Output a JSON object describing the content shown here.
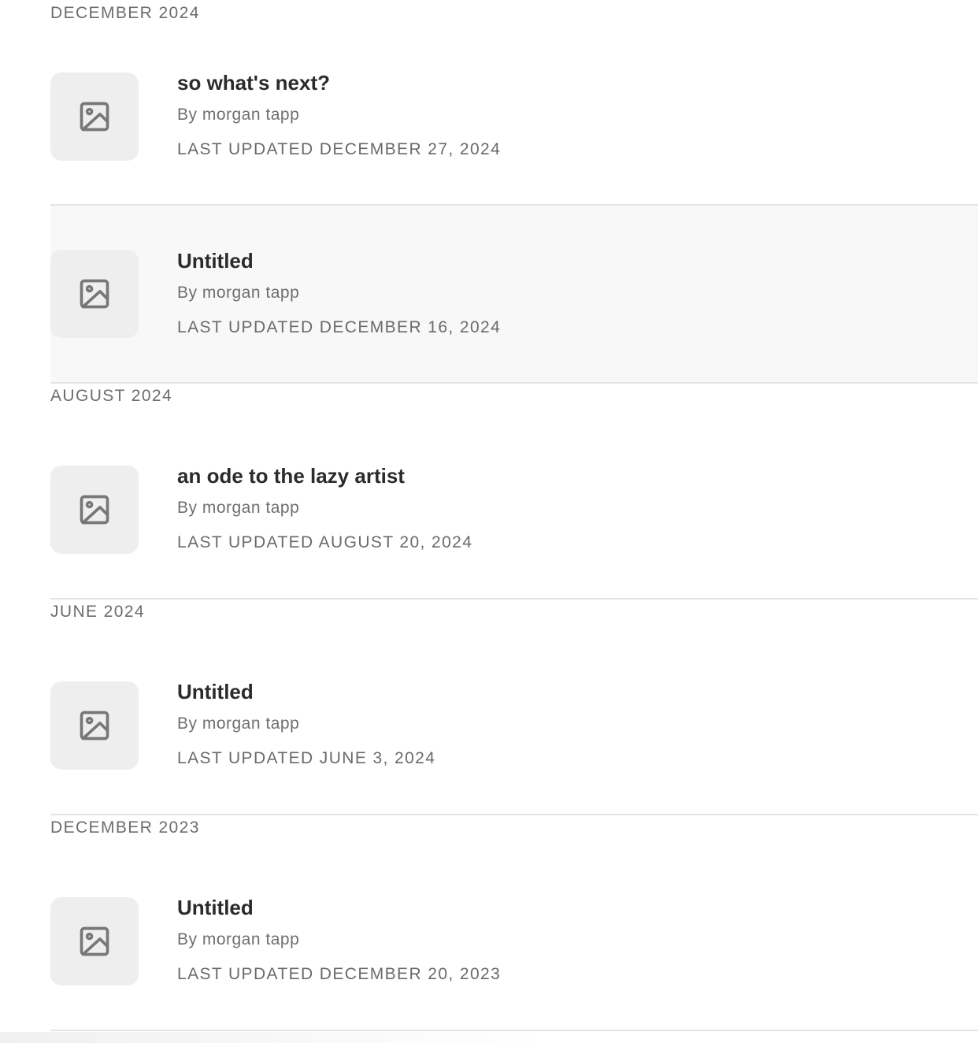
{
  "sections": [
    {
      "month": "DECEMBER 2024",
      "posts": [
        {
          "title": "so what's next?",
          "author": "By morgan tapp",
          "updated": "LAST UPDATED DECEMBER 27, 2024",
          "thumbnail_icon": "image-placeholder-icon"
        },
        {
          "title": "Untitled",
          "author": "By morgan tapp",
          "updated": "LAST UPDATED DECEMBER 16, 2024",
          "thumbnail_icon": "image-placeholder-icon"
        }
      ]
    },
    {
      "month": "AUGUST 2024",
      "posts": [
        {
          "title": "an ode to the lazy artist",
          "author": "By morgan tapp",
          "updated": "LAST UPDATED AUGUST 20, 2024",
          "thumbnail_icon": "image-placeholder-icon"
        }
      ]
    },
    {
      "month": "JUNE 2024",
      "posts": [
        {
          "title": "Untitled",
          "author": "By morgan tapp",
          "updated": "LAST UPDATED JUNE 3, 2024",
          "thumbnail_icon": "image-placeholder-icon"
        }
      ]
    },
    {
      "month": "DECEMBER 2023",
      "posts": [
        {
          "title": "Untitled",
          "author": "By morgan tapp",
          "updated": "LAST UPDATED DECEMBER 20, 2023",
          "thumbnail_icon": "image-placeholder-icon"
        }
      ]
    }
  ],
  "colors": {
    "thumbnail_bg": "#eeeeee",
    "highlight_row_bg": "#f8f8f8",
    "divider": "#e4e4e4",
    "title_text": "#2b2b2b",
    "meta_text": "#6d6d6d"
  }
}
